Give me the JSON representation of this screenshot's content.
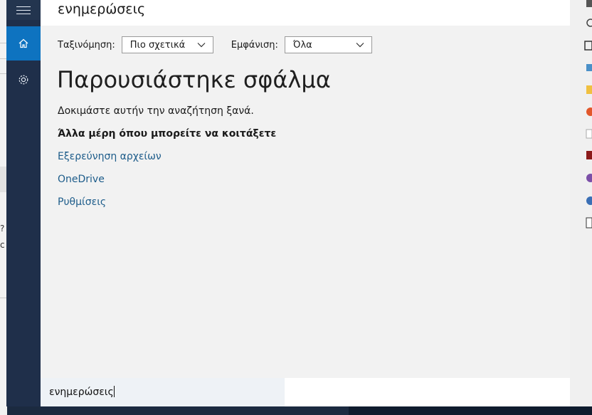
{
  "header": {
    "title": "ενημερώσεις"
  },
  "sidebar": {
    "menu_icon": "hamburger-icon",
    "home_icon": "home-icon",
    "settings_icon": "gear-icon",
    "accent": "#0e73c0"
  },
  "filters": {
    "sort_label": "Ταξινόμηση:",
    "sort_value": "Πιο σχετικά",
    "show_label": "Εμφάνιση:",
    "show_value": "Όλα"
  },
  "results": {
    "error_title": "Παρουσιάστηκε σφάλμα",
    "retry_text": "Δοκιμάστε αυτήν την αναζήτηση ξανά.",
    "other_places_heading": "Άλλα μέρη όπου μπορείτε να κοιτάξετε",
    "links": [
      "Εξερεύνηση αρχείων",
      "OneDrive",
      "Ρυθμίσεις"
    ],
    "link_color": "#1d5c8a"
  },
  "search": {
    "value": "ενημερώσεις"
  },
  "background": {
    "left_text_1": "?",
    "left_text_2": "c"
  }
}
